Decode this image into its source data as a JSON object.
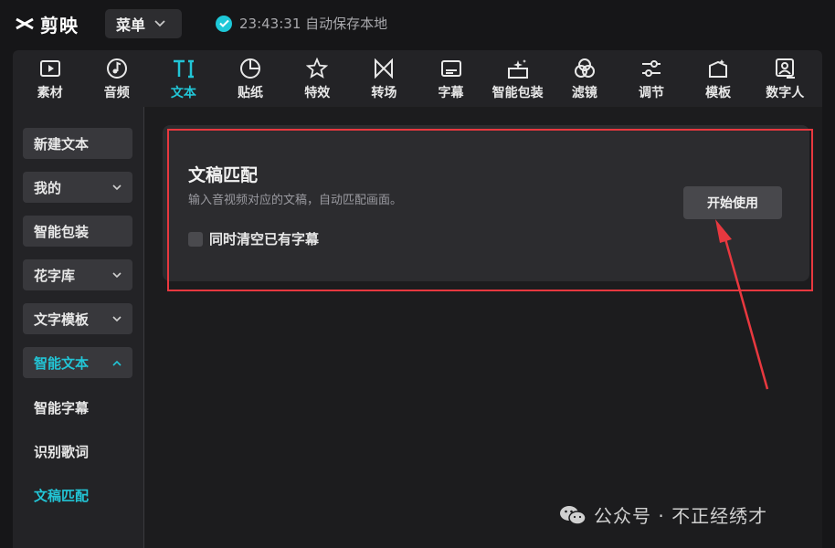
{
  "app": {
    "name": "剪映"
  },
  "titlebar": {
    "menu_label": "菜单",
    "save_status": "23:43:31 自动保存本地"
  },
  "toolbar": {
    "items": [
      {
        "label": "素材",
        "icon": "play-box-icon"
      },
      {
        "label": "音频",
        "icon": "music-note-icon"
      },
      {
        "label": "文本",
        "icon": "text-ti-icon",
        "active": true
      },
      {
        "label": "贴纸",
        "icon": "sticker-icon"
      },
      {
        "label": "特效",
        "icon": "star-effect-icon"
      },
      {
        "label": "转场",
        "icon": "transition-icon"
      },
      {
        "label": "字幕",
        "icon": "subtitle-icon"
      },
      {
        "label": "智能包装",
        "icon": "sparkle-package-icon"
      },
      {
        "label": "滤镜",
        "icon": "filter-icon"
      },
      {
        "label": "调节",
        "icon": "adjust-sliders-icon"
      },
      {
        "label": "模板",
        "icon": "template-icon"
      },
      {
        "label": "数字人",
        "icon": "digital-human-icon"
      }
    ]
  },
  "sidebar": {
    "items": [
      {
        "label": "新建文本"
      },
      {
        "label": "我的"
      },
      {
        "label": "智能包装"
      },
      {
        "label": "花字库"
      },
      {
        "label": "文字模板"
      },
      {
        "label": "智能文本"
      }
    ],
    "subitems": [
      {
        "label": "智能字幕"
      },
      {
        "label": "识别歌词"
      },
      {
        "label": "文稿匹配"
      }
    ]
  },
  "card": {
    "title": "文稿匹配",
    "description": "输入音视频对应的文稿，自动匹配画面。",
    "checkbox_label": "同时清空已有字幕",
    "checkbox_checked": false,
    "start_button": "开始使用"
  },
  "annotation": {
    "color": "#e8383f"
  },
  "watermark": {
    "text": "公众号 · 不正经绣才"
  },
  "colors": {
    "accent": "#22c5d6",
    "background": "#161618"
  }
}
